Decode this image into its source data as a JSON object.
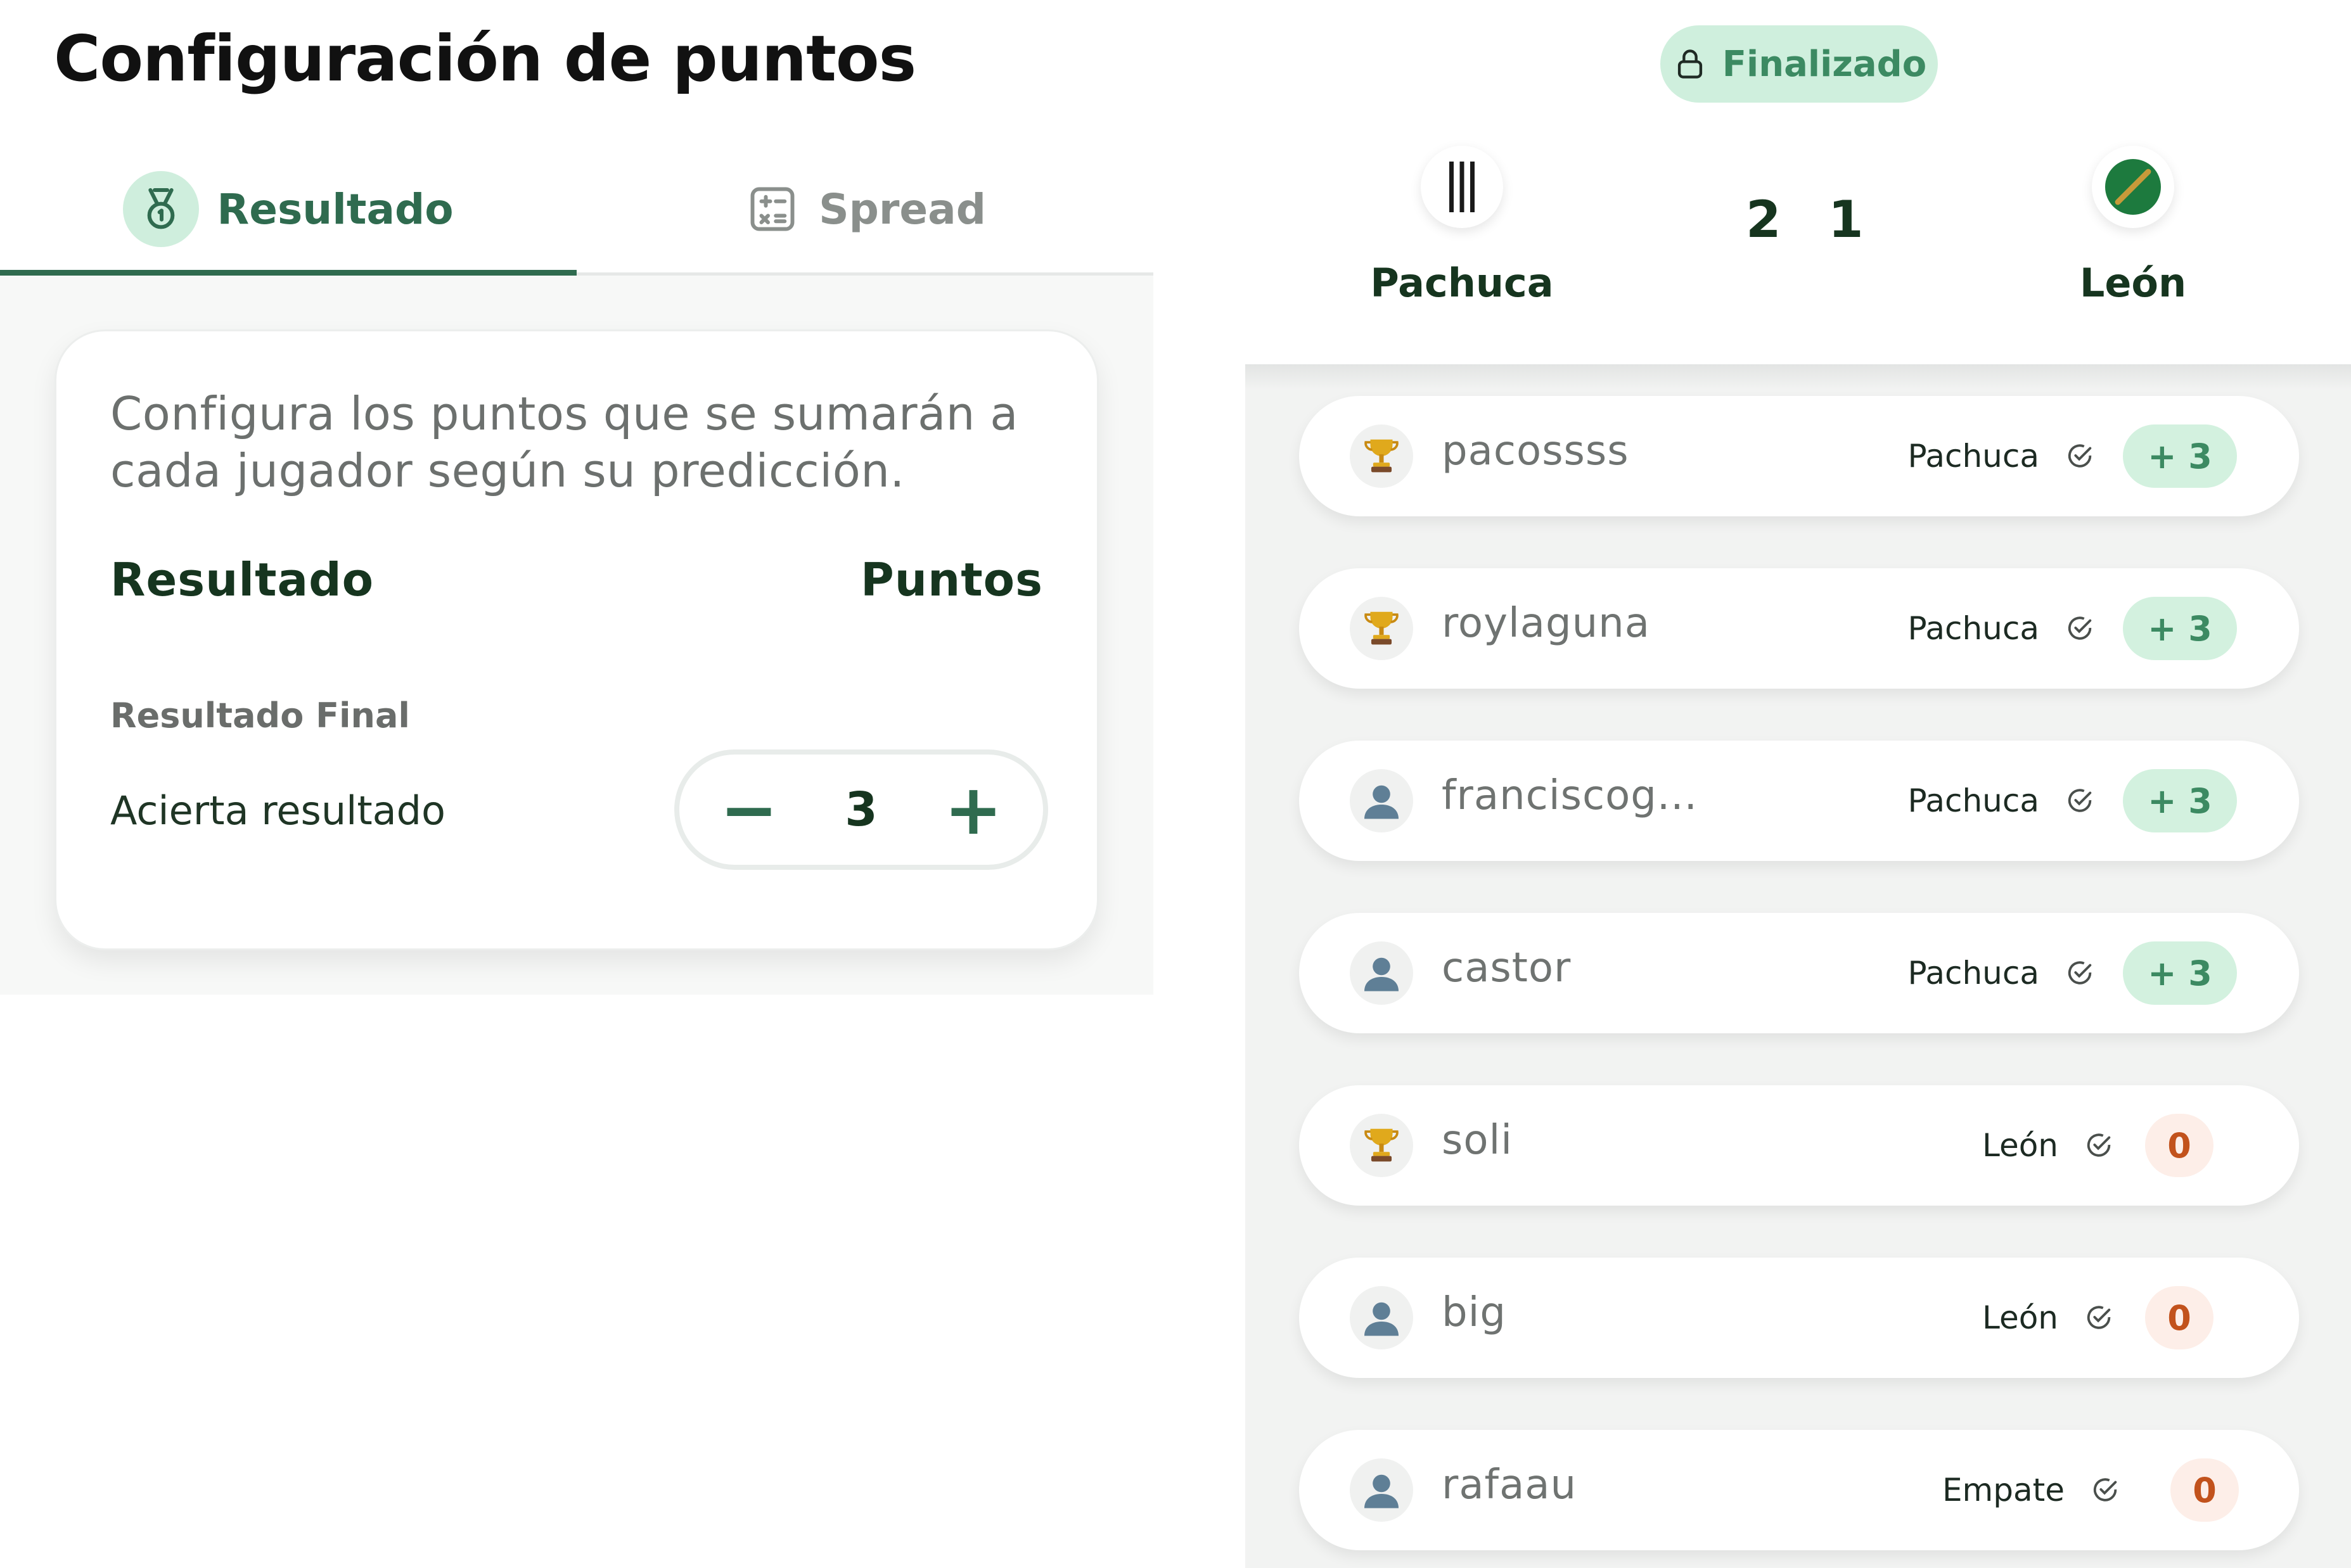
{
  "config": {
    "title": "Configuración de puntos",
    "tabs": [
      {
        "label": "Resultado",
        "icon": "medal-icon",
        "active": true
      },
      {
        "label": "Spread",
        "icon": "calculator-icon",
        "active": false
      }
    ],
    "card": {
      "description": "Configura los puntos que se sumarán a cada jugador según su predicción.",
      "col_result": "Resultado",
      "col_points": "Puntos",
      "section": "Resultado Final",
      "row_label": "Acierta resultado",
      "stepper": {
        "minus": "−",
        "value": "3",
        "plus": "+"
      }
    }
  },
  "match": {
    "status": "Finalizado",
    "status_icon": "lock-icon",
    "home": {
      "name": "Pachuca",
      "score": "2"
    },
    "away": {
      "name": "León",
      "score": "1"
    }
  },
  "predictions": [
    {
      "user": "pacossss",
      "avatar": "trophy-icon",
      "pick": "Pachuca",
      "points": "+ 3",
      "win": true
    },
    {
      "user": "roylaguna",
      "avatar": "trophy-icon",
      "pick": "Pachuca",
      "points": "+ 3",
      "win": true
    },
    {
      "user": "franciscog...",
      "avatar": "user-icon",
      "pick": "Pachuca",
      "points": "+ 3",
      "win": true
    },
    {
      "user": "castor",
      "avatar": "user-icon",
      "pick": "Pachuca",
      "points": "+ 3",
      "win": true
    },
    {
      "user": "soli",
      "avatar": "trophy-icon",
      "pick": "León",
      "points": "0",
      "win": false
    },
    {
      "user": "big",
      "avatar": "user-icon",
      "pick": "León",
      "points": "0",
      "win": false
    },
    {
      "user": "rafaau",
      "avatar": "user-icon",
      "pick": "Empate",
      "points": "0",
      "win": false
    }
  ],
  "colors": {
    "accent": "#2f6b4f",
    "win_bg": "#d3f1df",
    "lose_bg": "#fdeee8",
    "lose_text": "#c2521c"
  }
}
